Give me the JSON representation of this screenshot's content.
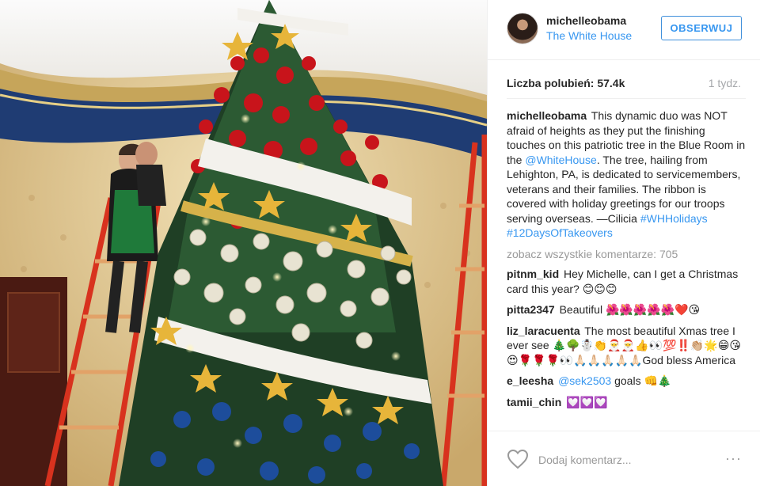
{
  "post": {
    "username": "michelleobama",
    "location": "The White House",
    "follow_label": "OBSERWUJ",
    "likes": "Liczba polubień: 57.4k",
    "age": "1 tydz.",
    "caption": {
      "user": "michelleobama",
      "text_1": "This dynamic duo was NOT afraid of heights as they put the finishing touches on this patriotic tree in the Blue Room in the ",
      "mention": "@WhiteHouse",
      "text_2": ". The tree, hailing from Lehighton, PA, is dedicated to servicemembers, veterans and their families. The ribbon is covered with holiday greetings for our troops serving overseas. —Cilicia ",
      "hashtag_1": "#WHHolidays",
      "hashtag_2": "#12DaysOfTakeovers"
    },
    "view_all": "zobacz wszystkie komentarze: 705",
    "comments": [
      {
        "user": "pitnm_kid",
        "text": "Hey Michelle, can I get a Christmas card this year? 😊😊😊"
      },
      {
        "user": "pitta2347",
        "text": "Beautiful 🌺🌺🌺🌺🌺❤️😘"
      },
      {
        "user": "liz_laracuenta",
        "text": "The most beautiful Xmas tree I ever see 🎄🌳☃️👏🎅🎅👍👀💯‼️👏🏼🌟😁😘😍🌹🌹🌹👀🙏🏻🙏🏻🙏🏻🙏🏻🙏🏻God bless America"
      },
      {
        "user": "e_leesha",
        "mention": "@sek2503",
        "text": " goals 👊🎄"
      },
      {
        "user": "tamii_chin",
        "text": "💟💟💟"
      }
    ],
    "add_comment_placeholder": "Dodaj komentarz...",
    "more_label": "···"
  },
  "colors": {
    "link": "#3897f0",
    "muted": "#999999",
    "text": "#262626"
  }
}
